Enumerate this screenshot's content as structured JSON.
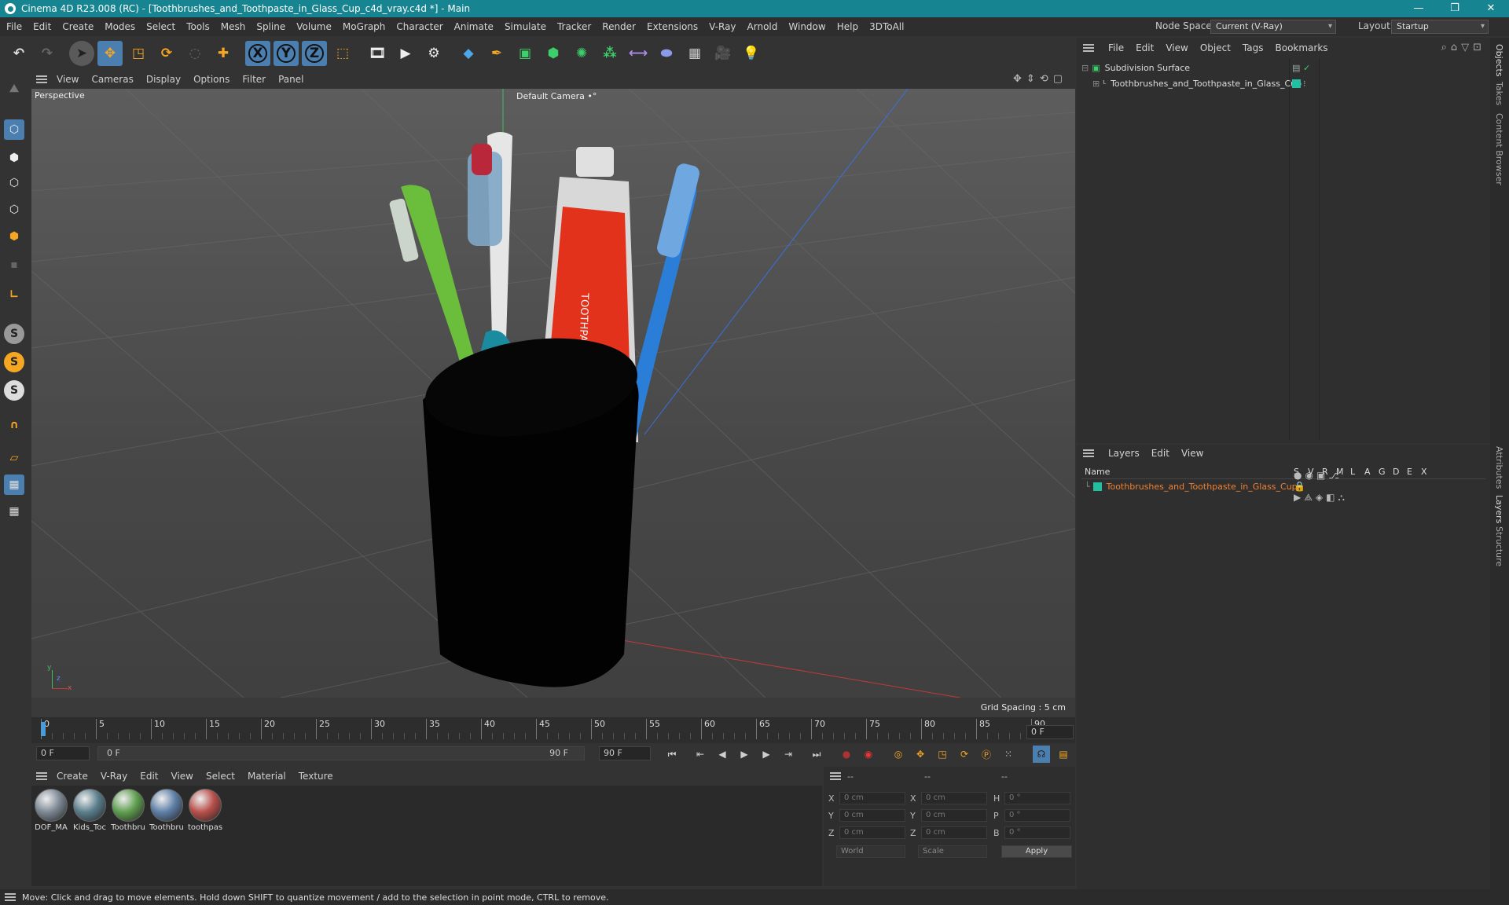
{
  "window": {
    "title": "Cinema 4D R23.008 (RC) - [Toothbrushes_and_Toothpaste_in_Glass_Cup_c4d_vray.c4d *] - Main",
    "controls": [
      "—",
      "❐",
      "✕"
    ]
  },
  "menubar": [
    "File",
    "Edit",
    "Create",
    "Modes",
    "Select",
    "Tools",
    "Mesh",
    "Spline",
    "Volume",
    "MoGraph",
    "Character",
    "Animate",
    "Simulate",
    "Tracker",
    "Render",
    "Extensions",
    "V-Ray",
    "Arnold",
    "Window",
    "Help",
    "3DToAll"
  ],
  "nodespace": {
    "label": "Node Space:",
    "value": "Current (V-Ray)"
  },
  "layout": {
    "label": "Layout:",
    "value": "Startup"
  },
  "toolbar_icons": [
    "undo-icon",
    "redo-icon",
    "live-select-icon",
    "move-icon",
    "scale-icon",
    "rotate-icon",
    "recent-tools-icon",
    "create-object-icon",
    "x-axis-lock-icon",
    "y-axis-lock-icon",
    "z-axis-lock-icon",
    "coordinate-system-icon",
    "render-view-icon",
    "render-picture-viewer-icon",
    "render-settings-icon",
    "cube-icon",
    "pen-icon",
    "subdivision-icon",
    "extrude-icon",
    "cloner-icon",
    "array-icon",
    "deformer-icon",
    "field-icon",
    "floor-icon",
    "camera-icon",
    "light-icon"
  ],
  "toolbar_axis_labels": [
    "X",
    "Y",
    "Z"
  ],
  "viewport": {
    "menu": [
      "View",
      "Cameras",
      "Display",
      "Options",
      "Filter",
      "Panel"
    ],
    "name": "Perspective",
    "camera": "Default Camera",
    "camera_suffix": "•°",
    "grid_spacing": "Grid Spacing : 5 cm",
    "axis_y": "y",
    "axis_z": "z",
    "axis_x": "x",
    "tube_text": "TOOTHPASTE"
  },
  "timeline": {
    "ticks": [
      "0",
      "5",
      "10",
      "15",
      "20",
      "25",
      "30",
      "35",
      "40",
      "45",
      "50",
      "55",
      "60",
      "65",
      "70",
      "75",
      "80",
      "85",
      "90"
    ],
    "current_frame": "0 F"
  },
  "transport": {
    "start": "0 F",
    "range_start": "0 F",
    "range_end": "90 F",
    "end": "90 F"
  },
  "material_menu": [
    "Create",
    "V-Ray",
    "Edit",
    "View",
    "Select",
    "Material",
    "Texture"
  ],
  "materials": [
    {
      "label": "DOF_MA",
      "color": "#7d8894"
    },
    {
      "label": "Kids_Toc",
      "color": "#5a7e8c"
    },
    {
      "label": "Toothbru",
      "color": "#5f9e4f"
    },
    {
      "label": "Toothbru",
      "color": "#5e7fa6"
    },
    {
      "label": "toothpas",
      "color": "#b84f4a"
    }
  ],
  "coords": {
    "headers": [
      "--",
      "--",
      "--"
    ],
    "rows": [
      {
        "a": "X",
        "av": "0 cm",
        "b": "X",
        "bv": "0 cm",
        "c": "H",
        "cv": "0 °"
      },
      {
        "a": "Y",
        "av": "0 cm",
        "b": "Y",
        "bv": "0 cm",
        "c": "P",
        "cv": "0 °"
      },
      {
        "a": "Z",
        "av": "0 cm",
        "b": "Z",
        "bv": "0 cm",
        "c": "B",
        "cv": "0 °"
      }
    ],
    "mode1": "World",
    "mode2": "Scale",
    "apply": "Apply"
  },
  "objects_menu": [
    "File",
    "Edit",
    "View",
    "Object",
    "Tags",
    "Bookmarks"
  ],
  "objects": [
    {
      "name": "Subdivision Surface",
      "tag_color": "#9aa"
    },
    {
      "name": "Toothbrushes_and_Toothpaste_in_Glass_Cup",
      "tag_color": "#20c0a0"
    }
  ],
  "layers_menu": [
    "Layers",
    "Edit",
    "View"
  ],
  "layers_header": {
    "name": "Name",
    "cols": [
      "S",
      "V",
      "R",
      "M",
      "L",
      "A",
      "G",
      "D",
      "E",
      "X"
    ]
  },
  "layers": [
    {
      "name": "Toothbrushes_and_Toothpaste_in_Glass_Cup",
      "color": "#20c0a0"
    }
  ],
  "side_tabs": [
    "Objects",
    "Takes",
    "Content Browser",
    "Attributes",
    "Layers",
    "Structure"
  ],
  "status": "Move: Click and drag to move elements. Hold down SHIFT to quantize movement / add to the selection in point mode, CTRL to remove.",
  "colors": {
    "titlebar": "#178591",
    "accent": "#4a9bd8",
    "layer_text": "#f08030"
  }
}
